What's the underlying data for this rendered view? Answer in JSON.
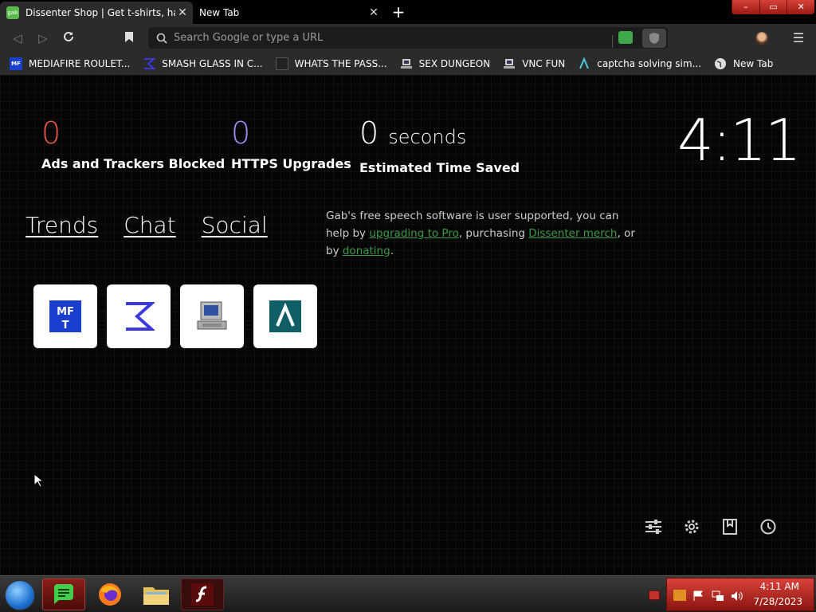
{
  "tabs": [
    {
      "title": "Dissenter Shop | Get t-shirts, hats,",
      "favicon": "gab",
      "active": true
    },
    {
      "title": "New Tab",
      "active": false
    }
  ],
  "new_tab_label": "+",
  "window_controls": [
    "–",
    "▭",
    "✕"
  ],
  "omnibox": {
    "placeholder": "Search Google or type a URL",
    "value": ""
  },
  "bookmarks": [
    {
      "label": "MEDIAFIRE ROULET...",
      "icon": "mediafire-icon"
    },
    {
      "label": "SMASH GLASS IN C...",
      "icon": "sigma-icon"
    },
    {
      "label": "WHATS THE PASS...",
      "icon": "dark-square-icon"
    },
    {
      "label": "SEX DUNGEON",
      "icon": "computer-icon"
    },
    {
      "label": "VNC FUN",
      "icon": "computer-icon"
    },
    {
      "label": "captcha solving sim...",
      "icon": "lambda-icon"
    },
    {
      "label": "New Tab",
      "icon": "globe-icon"
    }
  ],
  "stats": {
    "ads_blocked": {
      "value": "0",
      "label": "Ads and Trackers Blocked",
      "color": "#e8534a"
    },
    "https_upgrades": {
      "value": "0",
      "label": "HTTPS Upgrades",
      "color": "#9d8cf2"
    },
    "time_saved": {
      "value": "0",
      "unit": "seconds",
      "label": "Estimated Time Saved",
      "color": "#ffffff"
    }
  },
  "clock": "4:11",
  "nav_links": [
    "Trends",
    "Chat",
    "Social"
  ],
  "support": {
    "text1": "Gab's free speech software is user supported, you can help by ",
    "link1": "upgrading to Pro",
    "text2": ", purchasing ",
    "link2": "Dissenter merch",
    "text3": ", or by ",
    "link3": "donating",
    "text4": "."
  },
  "tiles": [
    "mediafire-tile",
    "sigma-tile",
    "computer-tile",
    "lambda-tile"
  ],
  "taskbar": {
    "time": "4:11 AM",
    "date": "7/28/2023"
  },
  "colors": {
    "accent_green": "#3a9b45",
    "tray_red": "#c0322b"
  }
}
